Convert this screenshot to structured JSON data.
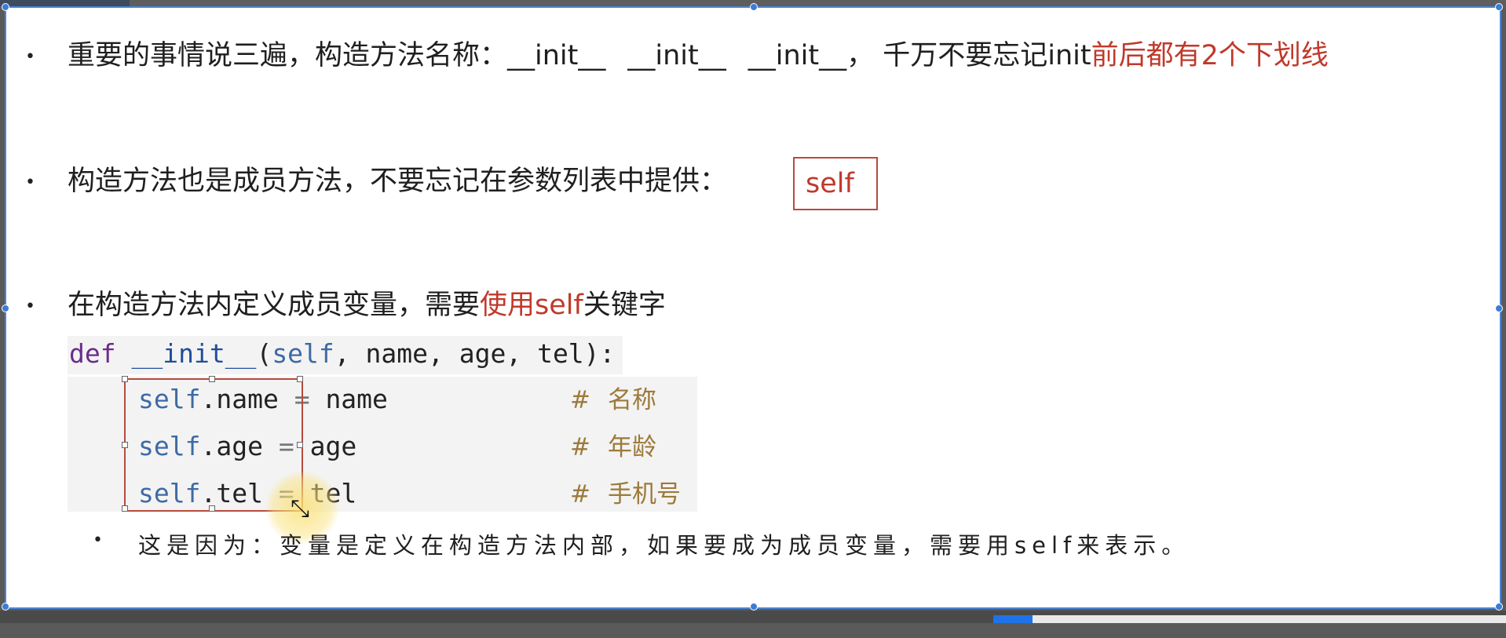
{
  "colors": {
    "accent": "#c0392b",
    "selection": "#4a86d8",
    "code_bg": "#f3f3f3"
  },
  "bullets": [
    {
      "prefix": "重要的事情说三遍，构造方法名称：",
      "code_names": [
        "__init__",
        "__init__",
        "__init__"
      ],
      "middle": "， 千万不要忘记init",
      "highlight": "前后都有2个下划线"
    },
    {
      "text": "构造方法也是成员方法，不要忘记在参数列表中提供：",
      "boxed": "self"
    },
    {
      "prefix": "在构造方法内定义成员变量，需要",
      "highlight": "使用self",
      "suffix": "关键字"
    }
  ],
  "code": {
    "def_kw": "def",
    "func_name": "__init__",
    "params_open": "(",
    "self_kw": "self",
    "params_rest": ", name, age, tel):",
    "rows": [
      {
        "self": "self",
        "attr": ".name",
        "op": " = ",
        "value": "name",
        "hash": "#",
        "comment": "名称"
      },
      {
        "self": "self",
        "attr": ".age",
        "op": " = ",
        "value": "age",
        "hash": "#",
        "comment": "年龄"
      },
      {
        "self": "self",
        "attr": ".tel",
        "op": " = ",
        "value": "tel",
        "hash": "#",
        "comment": "手机号"
      }
    ]
  },
  "sub_note": "这是因为：变量是定义在构造方法内部，如果要成为成员变量，需要用self来表示。",
  "icons": {
    "bullet": "bullet-dot-icon",
    "cursor": "resize-cursor-icon"
  }
}
